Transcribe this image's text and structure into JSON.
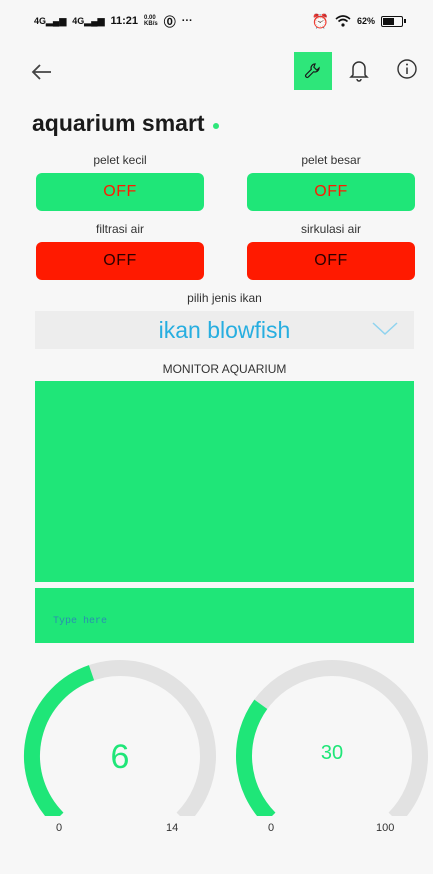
{
  "status": {
    "signal1": "4G",
    "signal2": "4G",
    "time": "11:21",
    "speed_top": "0.00",
    "speed_bottom": "KB/s",
    "more": "···",
    "battery": "62%",
    "battery_level": 0.62
  },
  "toolbar": {
    "back_icon": "arrow-left-icon",
    "tool_icon": "wrench-icon",
    "bell_icon": "bell-icon",
    "info_icon": "info-icon",
    "accent": "#2ee67a"
  },
  "title": "aquarium smart",
  "controls": [
    {
      "label": "pelet kecil",
      "value": "OFF",
      "color": "#1fe678"
    },
    {
      "label": "pelet besar",
      "value": "OFF",
      "color": "#1fe678"
    },
    {
      "label": "filtrasi air",
      "value": "OFF",
      "color": "#ff1a00"
    },
    {
      "label": "sirkulasi air",
      "value": "OFF",
      "color": "#ff1a00"
    }
  ],
  "fish_select": {
    "label": "pilih jenis ikan",
    "selected": "ikan blowfish"
  },
  "monitor": {
    "title": "MONITOR AQUARIUM",
    "terminal_placeholder": "Type here"
  },
  "gauges": [
    {
      "value": "6",
      "min": "0",
      "max": "14",
      "level": 0.43
    },
    {
      "value": "30",
      "min": "0",
      "max": "100",
      "level": 0.3
    }
  ]
}
